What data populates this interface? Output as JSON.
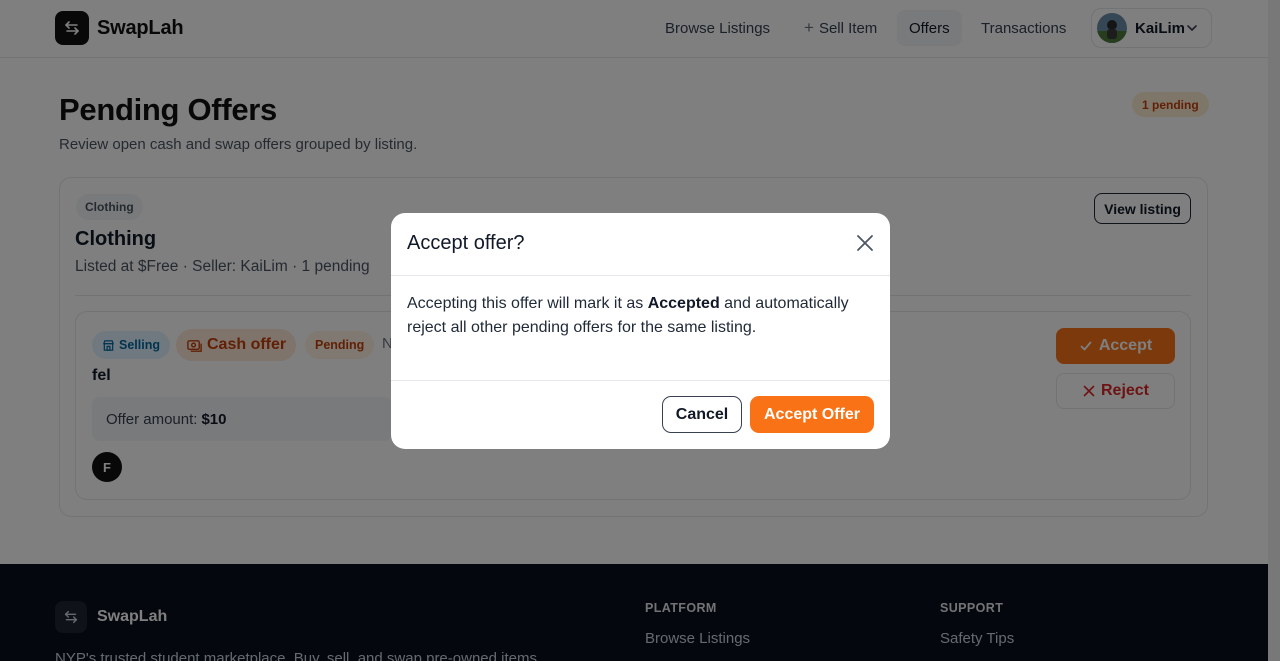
{
  "app": {
    "name": "SwapLah"
  },
  "nav": {
    "browse": "Browse Listings",
    "sell": "Sell Item",
    "offers": "Offers",
    "transactions": "Transactions",
    "user": "KaiLim"
  },
  "page": {
    "title": "Pending Offers",
    "subtitle": "Review open cash and swap offers grouped by listing.",
    "pending_badge": "1 pending"
  },
  "listing": {
    "category_chip": "Clothing",
    "title": "Clothing",
    "meta": "Listed at $Free · Seller: KaiLim · 1 pending",
    "view_button": "View listing"
  },
  "offer": {
    "selling_chip": "Selling",
    "type_chip": "Cash offer",
    "status_chip": "Pending",
    "extra_text": "N",
    "buyer": "fel",
    "amount_label": "Offer amount:",
    "amount_value": "$10",
    "buyer_initial": "F",
    "accept_label": "Accept",
    "reject_label": "Reject"
  },
  "modal": {
    "title": "Accept offer?",
    "body_pre": "Accepting this offer will mark it as ",
    "body_bold": "Accepted",
    "body_post": " and automatically reject all other pending offers for the same listing.",
    "cancel": "Cancel",
    "confirm": "Accept Offer"
  },
  "footer": {
    "brand": "SwapLah",
    "tagline": "NYP's trusted student marketplace. Buy, sell, and swap pre-owned items.",
    "platform_heading": "PLATFORM",
    "platform_link": "Browse Listings",
    "support_heading": "SUPPORT",
    "support_link": "Safety Tips"
  },
  "colors": {
    "accent": "#f97316",
    "danger": "#dc2626",
    "footer_bg": "#0b0f1c"
  },
  "icons": {
    "logo": "swap-arrows-icon",
    "plus": "plus-icon",
    "chevron": "chevron-down-icon",
    "close": "close-icon",
    "check": "check-icon",
    "x": "x-icon",
    "store": "store-icon",
    "cash": "cash-icon"
  }
}
